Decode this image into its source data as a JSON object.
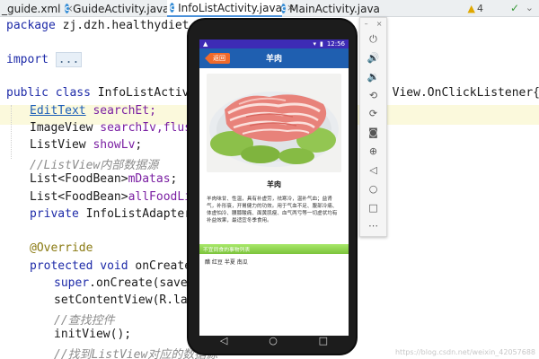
{
  "tabs": [
    {
      "label": "_guide.xml",
      "icon": "xml-file-icon",
      "active": false
    },
    {
      "label": "GuideActivity.java",
      "icon": "java-class-icon",
      "active": false
    },
    {
      "label": "InfoListActivity.java",
      "icon": "java-class-icon",
      "active": true
    },
    {
      "label": "MainActivity.java",
      "icon": "java-class-icon",
      "active": false
    }
  ],
  "tab_close": "×",
  "inspections": {
    "warnings": "4"
  },
  "code": {
    "l1a": "package ",
    "l1b": "zj.dzh.healthydiet.food",
    "l2a": "import ",
    "l2b": "...",
    "l3a": "public class ",
    "l3b": "InfoListActivity e",
    "l3c": "s View.OnClickListener{",
    "l4a": "EditText",
    "l4b": " searchEt;",
    "l5a": "ImageView ",
    "l5b": "searchIv,flushIv",
    "l6a": "ListView ",
    "l6b": "showLv",
    "l7": "//ListView内部数据源",
    "l8a": "List<FoodBean>",
    "l8b": "mDatas",
    "l9a": "List<FoodBean>",
    "l9b": "allFoodList",
    "l10a": "private ",
    "l10b": "InfoListAdapter ada",
    "l11": "@Override",
    "l12a": "protected void ",
    "l12b": "onCreate(Bun",
    "l13a": "super",
    "l13b": ".onCreate(savedIns",
    "l14": "setContentView(R.layout",
    "l15": "//查找控件",
    "l16": "initView();",
    "l17": "//找到ListView对应的数据源"
  },
  "watermark": "https://blog.csdn.net/weixin_42057688",
  "phone": {
    "status_time": "12:56",
    "back_label": "返回",
    "title": "羊肉",
    "food_name": "羊肉",
    "description": "羊肉味甘、性温，具有补虚劳，祛寒冷，温补气血；益肾气，补形衰，开胃健力的功效。用于气血不足、腹部冷痛、体虚怕冷、腰膝酸痛、面黄肌瘦、血气两亏等一切虚状均有补益效果，最适宜冬季食用。",
    "avoid_header": "不宜同食的事物列表",
    "avoid_items": "醋 红豆 半夏 南瓜"
  },
  "emulator_toolbar": {
    "min": "–",
    "close": "×",
    "icons": [
      "power-icon",
      "volume-up-icon",
      "volume-down-icon",
      "rotate-left-icon",
      "rotate-right-icon",
      "camera-icon",
      "zoom-icon",
      "back-icon",
      "home-icon",
      "overview-icon",
      "more-icon"
    ]
  }
}
